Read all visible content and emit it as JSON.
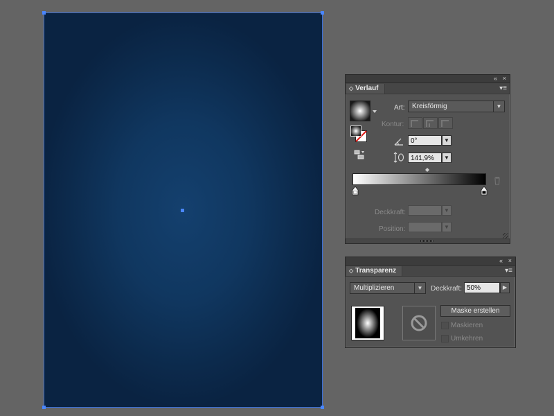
{
  "canvas": {
    "artboard_gradient": {
      "inner": "#14406e",
      "outer": "#0a2342"
    },
    "selection_color": "#4a86ff"
  },
  "gradient_panel": {
    "collapse_icon": "«",
    "close_icon": "×",
    "tab_label": "Verlauf",
    "tab_arrow": "◇",
    "menu_icon": "▾≡",
    "art_label": "Art:",
    "art_value": "Kreisförmig",
    "kontur_label": "Kontur:",
    "angle_value": "0°",
    "aspect_value": "141,9%",
    "deckkraft_label": "Deckkraft:",
    "position_label": "Position:",
    "stops": {
      "left_color": "#ffffff",
      "right_color": "#000000"
    }
  },
  "transparency_panel": {
    "collapse_icon": "«",
    "close_icon": "×",
    "tab_label": "Transparenz",
    "tab_arrow": "◇",
    "menu_icon": "▾≡",
    "blend_mode": "Multiplizieren",
    "opacity_label": "Deckkraft:",
    "opacity_value": "50%",
    "make_mask_button": "Maske erstellen",
    "clip_label": "Maskieren",
    "invert_label": "Umkehren"
  }
}
